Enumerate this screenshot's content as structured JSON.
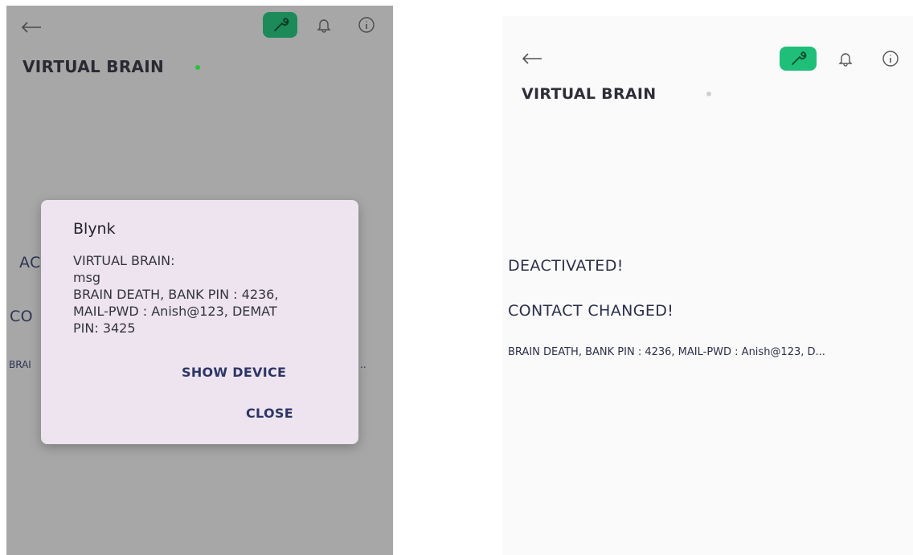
{
  "colors": {
    "accent_green": "#1fbf7a",
    "online_dot": "#2fbf3c",
    "offline_dot": "#cfcfcf",
    "dim_overlay": "#a7a7a7",
    "dialog_bg": "#ede4ef",
    "button_text": "#2d3566"
  },
  "left_screen": {
    "header": {
      "back_icon": "arrow-left-icon",
      "wrench_icon": "wrench-icon",
      "bell_icon": "bell-icon",
      "info_icon": "info-icon",
      "title": "VIRTUAL BRAIN",
      "status": "online"
    },
    "background_labels": {
      "line1_partial": "AC",
      "line2_partial": "CO",
      "line3_partial": "BRAI",
      "line3_ellipsis": ".."
    },
    "dialog": {
      "title": "Blynk",
      "body_lines": [
        "VIRTUAL BRAIN:",
        "msg",
        "BRAIN DEATH, BANK PIN : 4236,",
        "MAIL-PWD : Anish@123, DEMAT",
        "PIN: 3425"
      ],
      "show_device_label": "SHOW DEVICE",
      "close_label": "CLOSE"
    }
  },
  "right_screen": {
    "header": {
      "back_icon": "arrow-left-icon",
      "wrench_icon": "wrench-icon",
      "bell_icon": "bell-icon",
      "info_icon": "info-icon",
      "title": "VIRTUAL BRAIN",
      "status": "offline"
    },
    "labels": {
      "status_line": "DEACTIVATED!",
      "contact_line": "CONTACT CHANGED!",
      "message_line": "BRAIN DEATH, BANK PIN : 4236, MAIL-PWD : Anish@123, D..."
    }
  }
}
